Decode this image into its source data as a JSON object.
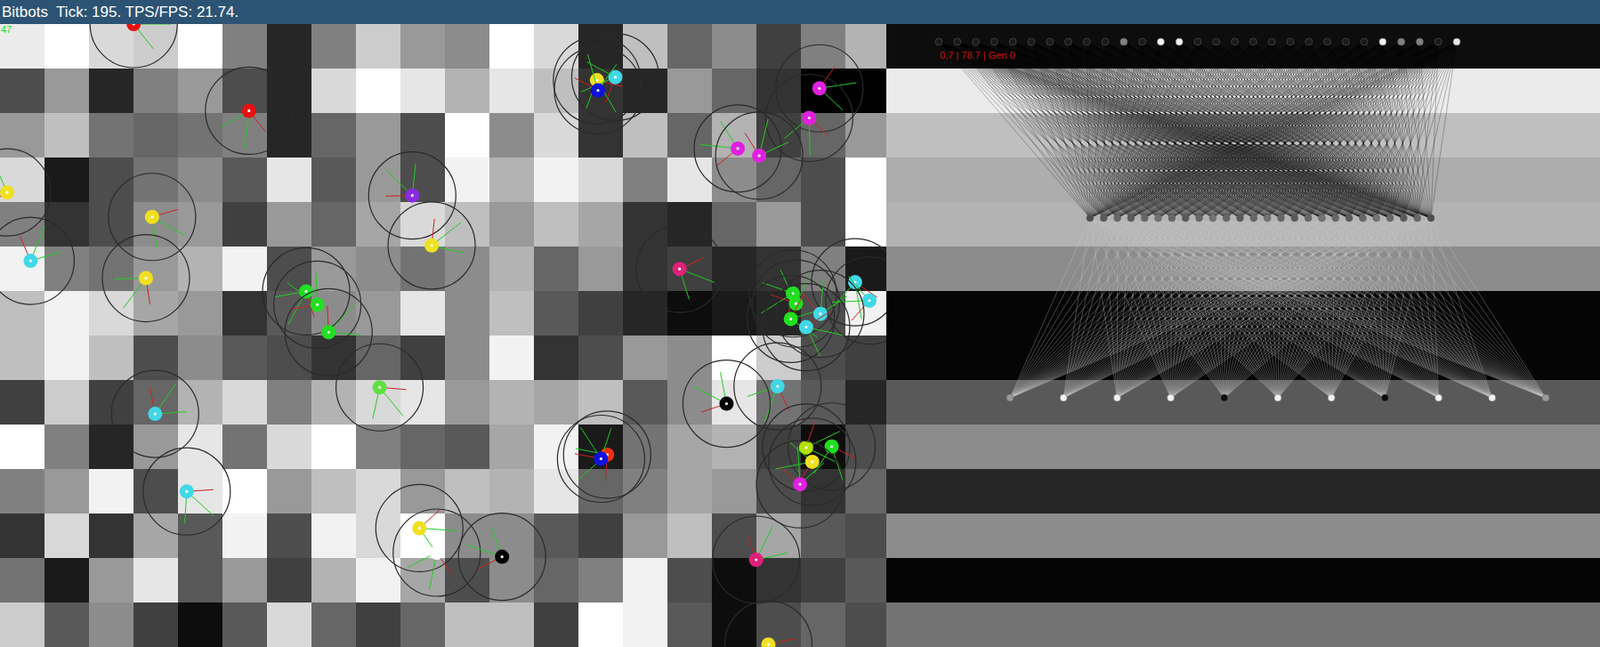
{
  "window": {
    "title": "Bitbots  Tick: 195. TPS/FPS: 21.74."
  },
  "world": {
    "counter": "47",
    "cells": [
      [
        0.92,
        1.0,
        0.85,
        0.8,
        1.0,
        0.5,
        0.15,
        0.5,
        0.8,
        0.6,
        0.55,
        1.0,
        0.85,
        0.15,
        0.75,
        0.4,
        0.55,
        0.25,
        0.5,
        0.7
      ],
      [
        0.3,
        0.6,
        0.15,
        0.5,
        0.6,
        0.3,
        0.15,
        0.85,
        1.0,
        0.9,
        0.7,
        0.9,
        0.75,
        0.2,
        0.15,
        0.6,
        0.4,
        0.2,
        0.0,
        0.0
      ],
      [
        0.6,
        0.75,
        0.45,
        0.4,
        0.45,
        0.5,
        0.15,
        0.4,
        0.6,
        0.3,
        1.0,
        0.55,
        0.85,
        0.2,
        0.75,
        0.4,
        0.7,
        0.25,
        0.4,
        0.6
      ],
      [
        0.85,
        0.1,
        0.3,
        0.45,
        0.55,
        0.35,
        0.9,
        0.35,
        0.6,
        0.3,
        0.95,
        0.7,
        0.95,
        0.85,
        0.5,
        0.9,
        0.55,
        0.4,
        0.3,
        1.0
      ],
      [
        0.5,
        0.2,
        0.3,
        0.55,
        0.6,
        0.25,
        0.6,
        0.4,
        0.65,
        0.85,
        0.75,
        0.6,
        0.75,
        0.65,
        0.2,
        0.15,
        0.4,
        0.6,
        0.3,
        1.0
      ],
      [
        0.95,
        0.5,
        0.45,
        0.6,
        0.7,
        0.95,
        0.3,
        0.6,
        0.55,
        0.45,
        0.55,
        0.7,
        0.4,
        0.6,
        0.2,
        0.25,
        0.15,
        0.2,
        0.5,
        0.1
      ],
      [
        0.75,
        0.95,
        0.85,
        0.65,
        0.6,
        0.2,
        0.35,
        0.55,
        0.6,
        0.9,
        0.55,
        0.75,
        0.35,
        0.25,
        0.15,
        0.05,
        0.1,
        0.15,
        0.3,
        0.95
      ],
      [
        0.75,
        0.95,
        0.75,
        0.3,
        0.55,
        0.35,
        0.3,
        0.2,
        0.4,
        0.25,
        0.55,
        0.95,
        0.2,
        0.3,
        0.6,
        0.55,
        1.0,
        0.8,
        0.3,
        0.25
      ],
      [
        0.25,
        0.8,
        0.25,
        0.4,
        0.7,
        0.85,
        0.5,
        0.7,
        0.85,
        0.9,
        0.6,
        0.7,
        0.65,
        0.75,
        0.35,
        0.55,
        0.9,
        0.45,
        0.35,
        0.15
      ],
      [
        1.0,
        0.5,
        0.15,
        0.6,
        0.9,
        0.45,
        0.85,
        1.0,
        0.5,
        0.4,
        0.35,
        0.65,
        0.95,
        0.1,
        0.45,
        0.65,
        0.7,
        0.25,
        0.05,
        0.3
      ],
      [
        0.5,
        0.6,
        0.95,
        0.3,
        0.9,
        1.0,
        0.6,
        0.75,
        0.85,
        0.6,
        0.75,
        0.7,
        0.9,
        0.4,
        0.5,
        0.65,
        0.6,
        0.3,
        0.2,
        0.4
      ],
      [
        0.2,
        0.85,
        0.2,
        0.65,
        0.35,
        0.95,
        0.3,
        0.95,
        0.85,
        1.0,
        0.55,
        0.55,
        0.35,
        0.25,
        0.6,
        0.75,
        0.3,
        0.65,
        0.35,
        0.3
      ],
      [
        0.45,
        0.1,
        0.6,
        0.9,
        0.35,
        0.6,
        0.25,
        0.7,
        0.95,
        0.65,
        0.3,
        0.55,
        0.4,
        0.5,
        0.95,
        0.3,
        0.05,
        0.2,
        0.25,
        0.35
      ],
      [
        0.8,
        0.35,
        0.55,
        0.25,
        0.05,
        0.35,
        0.85,
        0.4,
        0.25,
        0.4,
        0.75,
        0.75,
        0.25,
        1.0,
        0.95,
        0.35,
        0.05,
        0.3,
        0.4,
        0.3
      ]
    ]
  },
  "bots": [
    {
      "color": "#e81010"
    },
    {
      "color": "#e81010"
    },
    {
      "color": "#f0e020"
    },
    {
      "color": "#40d8e8"
    },
    {
      "color": "#f0e020"
    },
    {
      "color": "#f0e020"
    },
    {
      "color": "#8a2be2"
    },
    {
      "color": "#f0e020"
    },
    {
      "color": "#f0e020"
    },
    {
      "color": "#40d8e8"
    },
    {
      "color": "#1010e0"
    },
    {
      "color": "#e020e0"
    },
    {
      "color": "#e020e0"
    },
    {
      "color": "#e020e0"
    },
    {
      "color": "#e020e0"
    },
    {
      "color": "#e0207a"
    },
    {
      "color": "#20e020"
    },
    {
      "color": "#20e020"
    },
    {
      "color": "#20e020"
    },
    {
      "color": "#60e040"
    },
    {
      "color": "#20e020"
    },
    {
      "color": "#20e020"
    },
    {
      "color": "#20e020"
    },
    {
      "color": "#40d8e8"
    },
    {
      "color": "#40d8e8"
    },
    {
      "color": "#40d8e8"
    },
    {
      "color": "#40d8e8"
    },
    {
      "color": "#40d8e8"
    },
    {
      "color": "#000000"
    },
    {
      "color": "#40d8e8"
    },
    {
      "color": "#40d8e8"
    },
    {
      "color": "#e83010"
    },
    {
      "color": "#1010e0"
    },
    {
      "color": "#b0e000"
    },
    {
      "color": "#20e020"
    },
    {
      "color": "#f0e020"
    },
    {
      "color": "#e020e0"
    },
    {
      "color": "#f0e020"
    },
    {
      "color": "#ffffff"
    },
    {
      "color": "#000000"
    },
    {
      "color": "#e0207a"
    },
    {
      "color": "#f0e020"
    }
  ],
  "network": {
    "stats": "0.7 | 78.7 | Gen 0",
    "inputs": [
      0.1,
      0.1,
      0.1,
      0.1,
      0.1,
      0.1,
      0.1,
      0.1,
      0.1,
      0.1,
      0.5,
      0.1,
      0.95,
      0.95,
      0.1,
      0.1,
      0.1,
      0.1,
      0.1,
      0.1,
      0.1,
      0.1,
      0.1,
      0.1,
      0.95,
      0.5,
      0.5,
      0.1,
      0.9
    ],
    "hidden": [
      0.3,
      0.35,
      0.4,
      0.35,
      0.4,
      0.45,
      0.4,
      0.35,
      0.4,
      0.45,
      0.4,
      0.35,
      0.4,
      0.45,
      0.4,
      0.35,
      0.4,
      0.45,
      0.4,
      0.35,
      0.4,
      0.45,
      0.4,
      0.35,
      0.4,
      0.3
    ],
    "outputs": [
      0.6,
      0.95,
      0.95,
      0.95,
      0.05,
      0.95,
      0.95,
      0.05,
      0.95,
      0.95,
      0.6
    ],
    "bands": [
      0.05,
      0.92,
      0.75,
      0.68,
      0.7,
      0.55,
      0.02,
      0.02,
      0.35,
      0.55,
      0.15,
      0.55,
      0.02,
      0.45
    ]
  }
}
